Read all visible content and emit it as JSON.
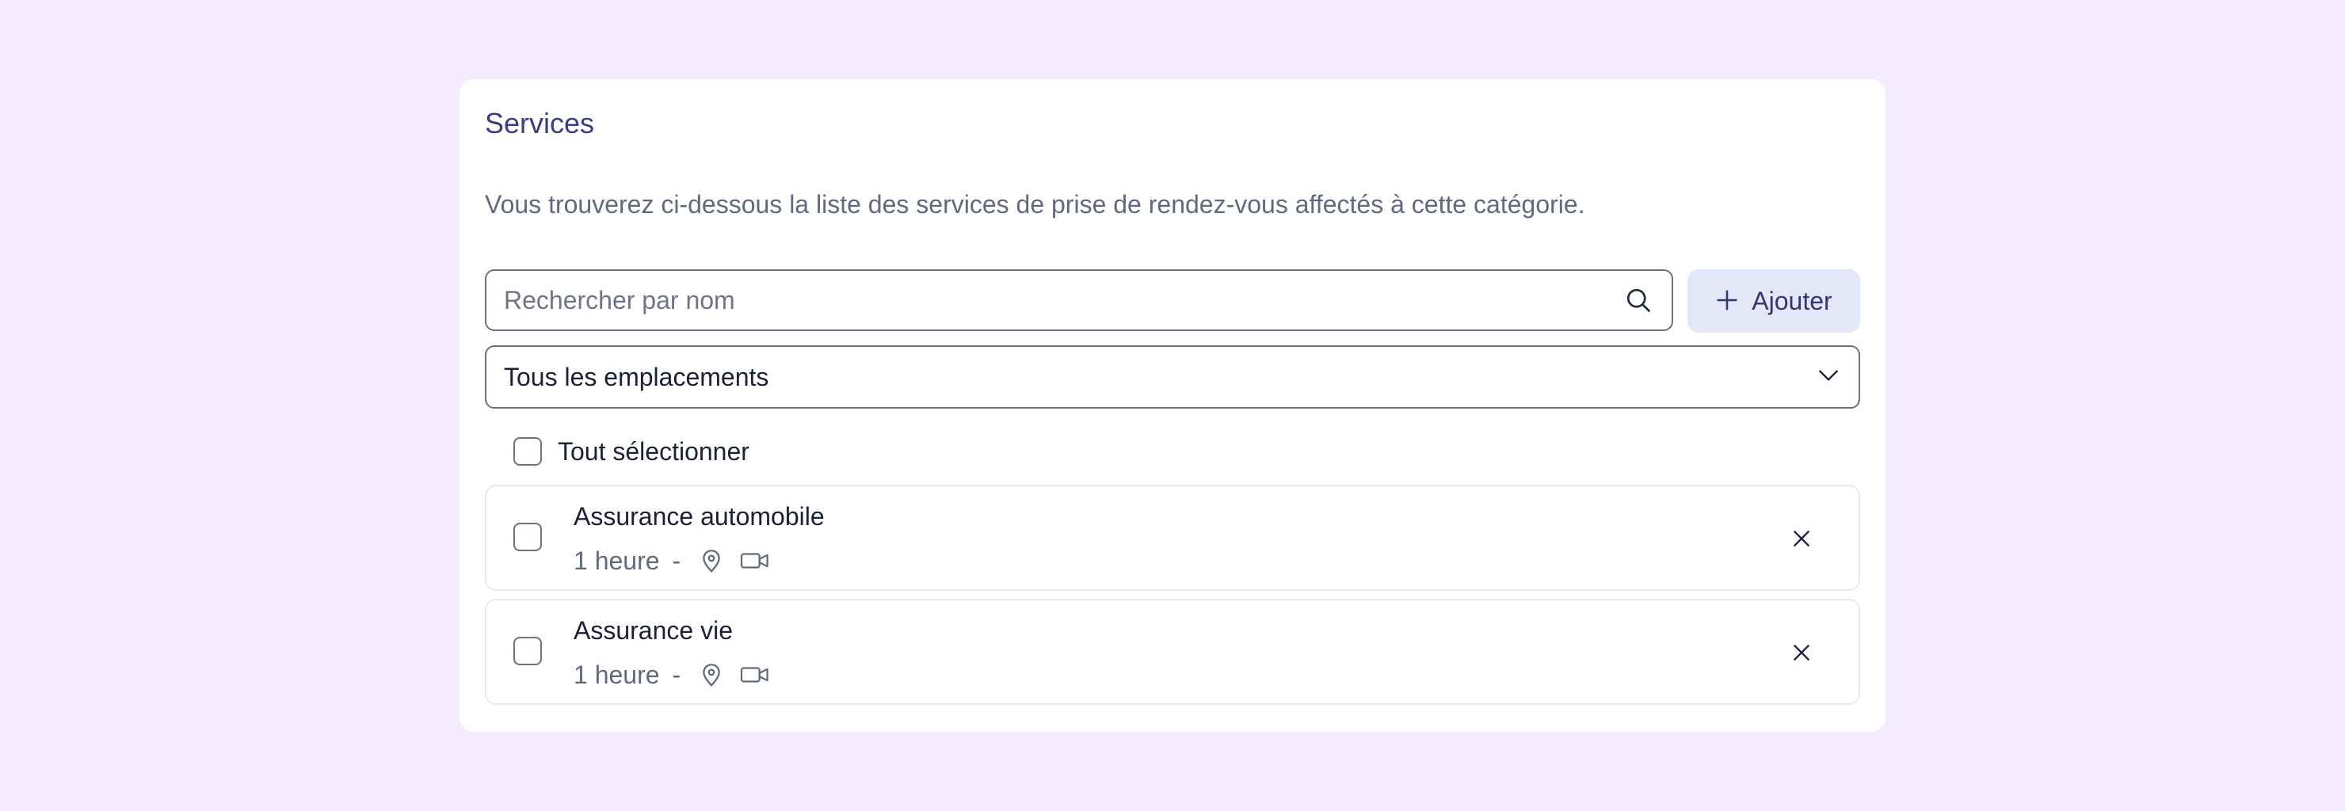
{
  "section": {
    "title": "Services",
    "description": "Vous trouverez ci-dessous la liste des services de prise de rendez-vous affectés à cette catégorie."
  },
  "search": {
    "placeholder": "Rechercher par nom",
    "value": "",
    "icon": "search-icon"
  },
  "add_button": {
    "label": "Ajouter",
    "icon": "plus-icon"
  },
  "location_filter": {
    "selected": "Tous les emplacements",
    "icon": "chevron-down-icon"
  },
  "select_all": {
    "label": "Tout sélectionner",
    "checked": false
  },
  "services": [
    {
      "name": "Assurance automobile",
      "duration": "1 heure",
      "separator": "-",
      "icons": [
        "map-pin-icon",
        "video-camera-icon"
      ],
      "checked": false
    },
    {
      "name": "Assurance vie",
      "duration": "1 heure",
      "separator": "-",
      "icons": [
        "map-pin-icon",
        "video-camera-icon"
      ],
      "checked": false
    }
  ],
  "colors": {
    "page_background": "#f4ecfd",
    "title": "#3d3d86",
    "text_muted": "#5f6a80",
    "button_background": "#e3e7f8",
    "border": "#6d7085"
  }
}
